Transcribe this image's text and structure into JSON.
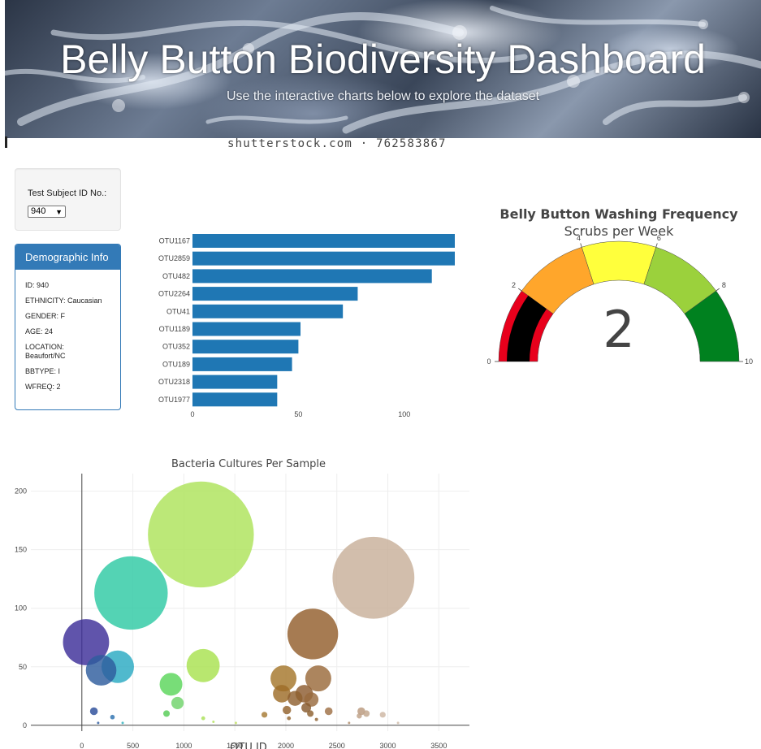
{
  "header": {
    "title": "Belly Button Biodiversity Dashboard",
    "lead": "Use the interactive charts below to explore the dataset",
    "watermark": "shutterstock.com · 762583867"
  },
  "selector": {
    "label": "Test Subject ID No.:",
    "selected": "940"
  },
  "demographics": {
    "title": "Demographic Info",
    "lines": [
      "ID: 940",
      "ETHNICITY: Caucasian",
      "GENDER: F",
      "AGE: 24",
      "LOCATION: Beaufort/NC",
      "BBTYPE: I",
      "WFREQ: 2"
    ]
  },
  "colors": {
    "bar": "#1f77b4",
    "panel": "#337ab7",
    "gauge_steps": [
      "#e8001c",
      "#ffa62b",
      "#ffff3c",
      "#9bd13c",
      "#00811f"
    ],
    "gauge_needle": "#000000"
  },
  "chart_data": [
    {
      "type": "bar",
      "orientation": "horizontal",
      "categories": [
        "OTU1167",
        "OTU2859",
        "OTU482",
        "OTU2264",
        "OTU41",
        "OTU1189",
        "OTU352",
        "OTU189",
        "OTU2318",
        "OTU1977"
      ],
      "values": [
        163,
        126,
        113,
        78,
        71,
        51,
        50,
        47,
        40,
        40
      ],
      "xticks": [
        0,
        50,
        100
      ],
      "xlim": [
        0,
        125
      ]
    },
    {
      "type": "gauge",
      "title": "Belly Button Washing Frequency",
      "subtitle": "Scrubs per Week",
      "value": 2,
      "range": [
        0,
        10
      ],
      "ticks": [
        0,
        2,
        4,
        6,
        8,
        10
      ]
    },
    {
      "type": "scatter",
      "title": "Bacteria Cultures Per Sample",
      "xlabel": "OTU ID",
      "xticks": [
        0,
        500,
        1000,
        1500,
        2000,
        2500,
        3000,
        3500
      ],
      "yticks": [
        0,
        50,
        100,
        150,
        200
      ],
      "xlim": [
        -500,
        3800
      ],
      "ylim": [
        -5,
        215
      ],
      "grid": true,
      "points": [
        {
          "x": 41,
          "y": 71,
          "size": 71,
          "color": "#3d2e99"
        },
        {
          "x": 189,
          "y": 47,
          "size": 47,
          "color": "#2e5d9e"
        },
        {
          "x": 352,
          "y": 50,
          "size": 50,
          "color": "#2aa9c2"
        },
        {
          "x": 482,
          "y": 113,
          "size": 113,
          "color": "#2ec9a4"
        },
        {
          "x": 1167,
          "y": 163,
          "size": 163,
          "color": "#ade35a"
        },
        {
          "x": 1189,
          "y": 51,
          "size": 51,
          "color": "#a8e24f"
        },
        {
          "x": 874,
          "y": 35,
          "size": 35,
          "color": "#5ad65a"
        },
        {
          "x": 938,
          "y": 19,
          "size": 19,
          "color": "#6fd36a"
        },
        {
          "x": 2264,
          "y": 78,
          "size": 78,
          "color": "#935e2c"
        },
        {
          "x": 2859,
          "y": 126,
          "size": 126,
          "color": "#c8b09a"
        },
        {
          "x": 1977,
          "y": 40,
          "size": 40,
          "color": "#a5762b"
        },
        {
          "x": 2318,
          "y": 40,
          "size": 40,
          "color": "#9a6a3a"
        },
        {
          "x": 1960,
          "y": 27,
          "size": 27,
          "color": "#9e6d28"
        },
        {
          "x": 2090,
          "y": 23,
          "size": 23,
          "color": "#8f6030"
        },
        {
          "x": 2180,
          "y": 27,
          "size": 27,
          "color": "#8c5c30"
        },
        {
          "x": 2250,
          "y": 22,
          "size": 22,
          "color": "#996a3e"
        },
        {
          "x": 2200,
          "y": 15,
          "size": 15,
          "color": "#875a2e"
        },
        {
          "x": 118,
          "y": 12,
          "size": 12,
          "color": "#2b4d9a"
        },
        {
          "x": 300,
          "y": 7,
          "size": 7,
          "color": "#2d71b0"
        },
        {
          "x": 830,
          "y": 10,
          "size": 10,
          "color": "#55cc55"
        },
        {
          "x": 1190,
          "y": 6,
          "size": 6,
          "color": "#aae057"
        },
        {
          "x": 1790,
          "y": 9,
          "size": 9,
          "color": "#a67a33"
        },
        {
          "x": 2010,
          "y": 13,
          "size": 13,
          "color": "#92612c"
        },
        {
          "x": 2240,
          "y": 10,
          "size": 10,
          "color": "#8e6030"
        },
        {
          "x": 2420,
          "y": 12,
          "size": 12,
          "color": "#9f7046"
        },
        {
          "x": 2740,
          "y": 12,
          "size": 12,
          "color": "#b9987c"
        },
        {
          "x": 2790,
          "y": 10,
          "size": 10,
          "color": "#c1a58b"
        },
        {
          "x": 2950,
          "y": 9,
          "size": 9,
          "color": "#cdb6a2"
        },
        {
          "x": 2720,
          "y": 8,
          "size": 8,
          "color": "#bea187"
        },
        {
          "x": 2030,
          "y": 6,
          "size": 6,
          "color": "#946530"
        },
        {
          "x": 2300,
          "y": 5,
          "size": 5,
          "color": "#8f6231"
        },
        {
          "x": 160,
          "y": 2,
          "size": 2,
          "color": "#2c5a9f"
        },
        {
          "x": 400,
          "y": 2,
          "size": 2,
          "color": "#2cb0bc"
        },
        {
          "x": 1290,
          "y": 3,
          "size": 3,
          "color": "#b3e35c"
        },
        {
          "x": 1510,
          "y": 2,
          "size": 2,
          "color": "#c0e060"
        },
        {
          "x": 2620,
          "y": 2,
          "size": 2,
          "color": "#b08c6a"
        },
        {
          "x": 3100,
          "y": 2,
          "size": 2,
          "color": "#d0bba8"
        }
      ]
    }
  ]
}
